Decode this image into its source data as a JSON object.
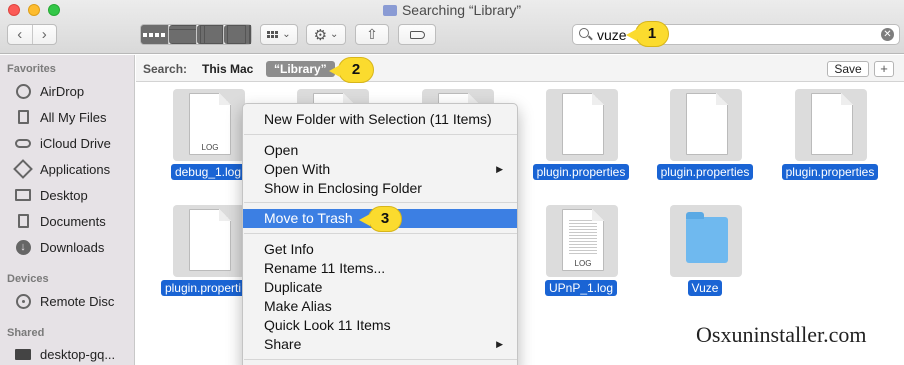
{
  "window": {
    "title": "Searching “Library”"
  },
  "toolbar": {
    "back": "‹",
    "forward": "›",
    "action_gear": "⚙",
    "share_arrow": "⇧",
    "chevron": "⌄"
  },
  "search": {
    "value": "vuze",
    "clear": "✕"
  },
  "callouts": [
    "1",
    "2",
    "3"
  ],
  "scope": {
    "label": "Search:",
    "this_mac": "This Mac",
    "library": "“Library”",
    "save": "Save",
    "plus": "+"
  },
  "sidebar": {
    "sections": [
      {
        "label": "Favorites"
      },
      {
        "label": "Devices"
      },
      {
        "label": "Shared"
      }
    ],
    "favorites": [
      "AirDrop",
      "All My Files",
      "iCloud Drive",
      "Applications",
      "Desktop",
      "Documents",
      "Downloads"
    ],
    "devices": [
      "Remote Disc"
    ],
    "shared": [
      "desktop-gq..."
    ]
  },
  "files": [
    {
      "name": "debug_1.log",
      "kind": "log",
      "tag": "LOG"
    },
    {
      "name": "plugin.properties",
      "kind": "doc"
    },
    {
      "name": "plugin.properties",
      "kind": "doc"
    },
    {
      "name": "plugin.properties",
      "kind": "doc"
    },
    {
      "name": "plugin.properti...",
      "kind": "doc"
    },
    {
      "name": "UPnP_1.log",
      "kind": "log",
      "tag": "LOG"
    },
    {
      "name": "Vuze",
      "kind": "folder"
    }
  ],
  "context_menu": {
    "items": [
      "New Folder with Selection (11 Items)",
      "Open",
      "Open With",
      "Show in Enclosing Folder",
      "Move to Trash",
      "Get Info",
      "Rename 11 Items...",
      "Duplicate",
      "Make Alias",
      "Quick Look 11 Items",
      "Share"
    ],
    "submenu_arrow": "▶"
  },
  "watermark": "Osxuninstaller.com",
  "colors": {
    "selection": "#1a64d4",
    "menu_highlight": "#3c7fe3",
    "callout": "#fbdb2e"
  }
}
